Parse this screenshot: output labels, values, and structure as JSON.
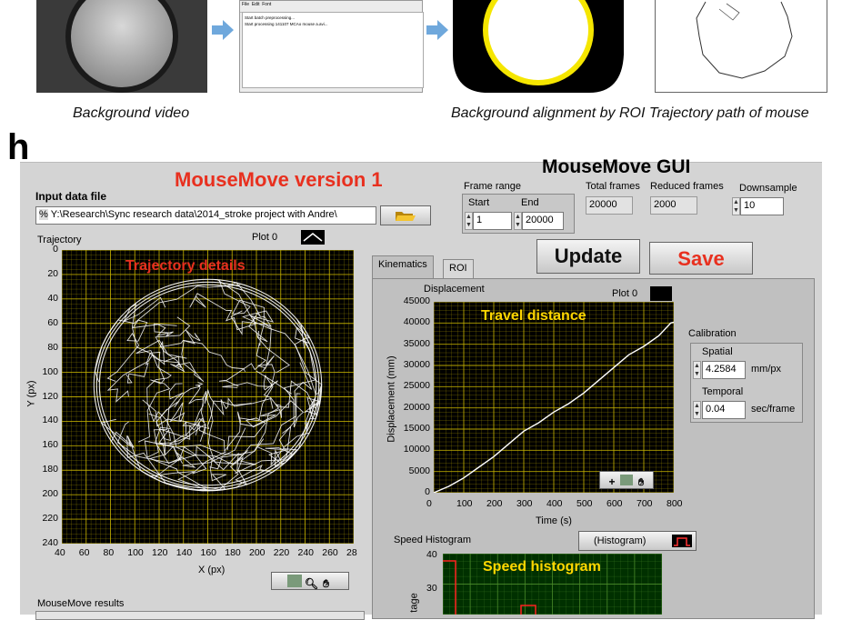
{
  "figure": {
    "panel_letter": "h",
    "captions": {
      "background_video": "Background video",
      "alignment": "Background alignment by ROI Trajectory path of mouse"
    },
    "screen_thumb": {
      "menu_items": [
        "File",
        "Edit",
        "Font"
      ],
      "lines": [
        "Start batch preprocessing...",
        "Start processing 141107 MCAo mouse a.avi..."
      ]
    },
    "gui_label": "MouseMove GUI"
  },
  "app": {
    "title": "MouseMove version 1",
    "title_color": "#e8301f",
    "input": {
      "label": "Input data file",
      "path_prefix": "%",
      "path": "Y:\\Research\\Sync research data\\2014_stroke project with Andre\\"
    },
    "frame_range": {
      "label": "Frame range",
      "start_label": "Start",
      "start": "1",
      "end_label": "End",
      "end": "20000"
    },
    "total_frames": {
      "label": "Total frames",
      "value": "20000"
    },
    "reduced_frames": {
      "label": "Reduced frames",
      "value": "2000"
    },
    "downsample": {
      "label": "Downsample",
      "value": "10"
    },
    "buttons": {
      "update": "Update",
      "save": "Save",
      "save_color": "#e8301f"
    },
    "tabs": [
      "Kinematics",
      "ROI"
    ],
    "calibration": {
      "label": "Calibration",
      "spatial_label": "Spatial",
      "spatial": "4.2584",
      "spatial_unit": "mm/px",
      "temporal_label": "Temporal",
      "temporal": "0.04",
      "temporal_unit": "sec/frame"
    },
    "results_label": "MouseMove results",
    "graph_tools": [
      "cursor-tool-icon",
      "zoom-tool-icon",
      "pan-hand-icon"
    ]
  },
  "chart_data": [
    {
      "type": "line",
      "title": "Trajectory",
      "overlay": "Trajectory details",
      "legend": "Plot 0",
      "xlabel": "X (px)",
      "ylabel": "Y (px)",
      "xlim": [
        40,
        280
      ],
      "ylim": [
        240,
        0
      ],
      "xticks": [
        "40",
        "60",
        "80",
        "100",
        "120",
        "140",
        "160",
        "180",
        "200",
        "220",
        "240",
        "260",
        "28"
      ],
      "yticks": [
        "0",
        "20",
        "40",
        "60",
        "80",
        "100",
        "120",
        "140",
        "160",
        "180",
        "200",
        "220",
        "240"
      ],
      "grid": true,
      "background": "#000000",
      "grid_color": "#c8b400",
      "line_color": "#ffffff"
    },
    {
      "type": "line",
      "title": "Displacement",
      "overlay": "Travel distance",
      "legend": "Plot 0",
      "xlabel": "Time (s)",
      "ylabel": "Displacement (mm)",
      "xlim": [
        0,
        800
      ],
      "ylim": [
        0,
        45000
      ],
      "xticks": [
        "0",
        "100",
        "200",
        "300",
        "400",
        "500",
        "600",
        "700",
        "800"
      ],
      "yticks": [
        "0",
        "5000",
        "10000",
        "15000",
        "20000",
        "25000",
        "30000",
        "35000",
        "40000",
        "45000"
      ],
      "grid": true,
      "background": "#000000",
      "grid_color": "#c8b400",
      "line_color": "#ffffff",
      "x": [
        0,
        50,
        100,
        150,
        200,
        250,
        300,
        350,
        400,
        450,
        500,
        550,
        600,
        650,
        700,
        750,
        790,
        800
      ],
      "y": [
        0,
        1500,
        3500,
        6000,
        8500,
        11500,
        14500,
        16500,
        19000,
        21000,
        23500,
        26500,
        29500,
        32500,
        34500,
        37000,
        40000,
        40200
      ]
    },
    {
      "type": "bar",
      "title": "Speed Histogram",
      "overlay": "Speed histogram",
      "legend": "(Histogram)",
      "ylabel": "tage",
      "yticks": [
        "30",
        "40"
      ],
      "grid": true,
      "background": "#003000",
      "grid_color": "#4a8a2a",
      "line_color": "#ff2020"
    }
  ]
}
